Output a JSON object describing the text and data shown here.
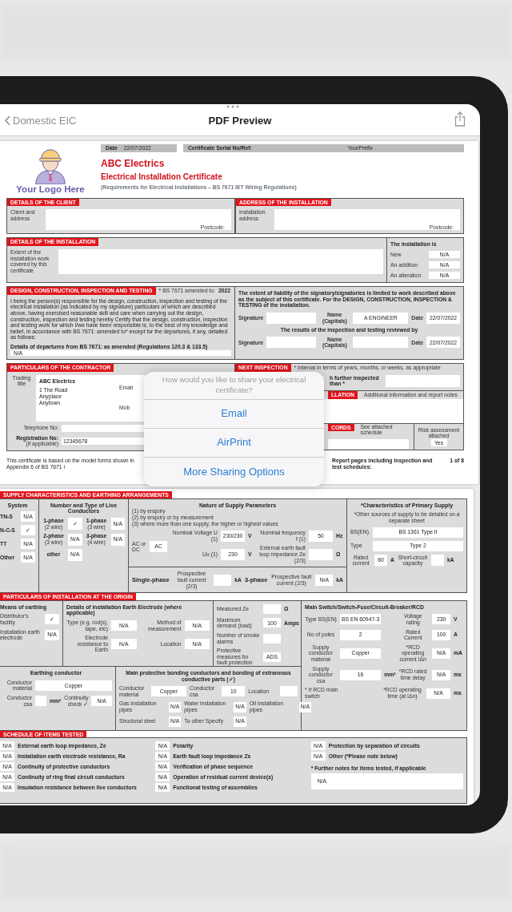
{
  "nav": {
    "back": "Domestic EIC",
    "title": "PDF Preview"
  },
  "page1": {
    "header": {
      "logo_text": "Your Logo Here",
      "date_label": "Date",
      "date": "22/07/2022",
      "serial_label": "Certificate Serial No/Ref:",
      "serial": "YourPrefix",
      "company": "ABC Electrics",
      "title": "Electrical Installation Certificate",
      "subtitle": "(Requirements for Electrical Installations – BS 7671 IET Wiring Regulations)"
    },
    "client": {
      "heading": "DETAILS OF THE CLIENT",
      "label": "Client and address",
      "postcode_label": "Postcode:"
    },
    "address": {
      "heading": "ADDRESS OF THE INSTALLATION",
      "label": "Installation address",
      "postcode_label": "Postcode:"
    },
    "installation": {
      "heading": "DETAILS OF THE INSTALLATION",
      "label": "Extent of the installation work covered by this certificate",
      "type_heading": "The installation is",
      "types": [
        {
          "label": "New",
          "value": "N/A"
        },
        {
          "label": "An addition",
          "value": "N/A"
        },
        {
          "label": "An alteration",
          "value": "N/A"
        }
      ]
    },
    "design": {
      "heading": "DESIGN, CONSTRUCTION, INSPECTION AND TESTING",
      "amended_label": "* BS 7671 amended to:",
      "amended_year": "2022",
      "statement": "I being the person(s) responsible for the design, construction, inspection and testing of the electrical installation (as indicated by my signature) particulars of which are described above, having exercised reasonable skill and care when carrying out the design, construction, inspection and testing hereby Certify that the design, construction, inspection and testing work for which I/we have been responsible is, to the best of my knowledge and belief, in accordance with BS 7671: amended to* except for the departures, if any, detailed as follows:",
      "departures_label": "Details of departures from BS 7671: as amended (Regulations 120.3 & 133.5)",
      "departures": "N/A"
    },
    "signatories": {
      "liability": "The extent of liability of the signatory/signatories is limited to work described above as the subject of this certificate. For the DESIGN, CONSTRUCTION, INSPECTION & TESTING of the installation.",
      "reviewed_label": "The results of the inspection and testing reviewed by",
      "rows": [
        {
          "signature_label": "Signature",
          "name_label": "Name (Capitals)",
          "name": "A ENGINEER",
          "date_label": "Date",
          "date": "22/07/2022"
        },
        {
          "signature_label": "Signature",
          "name_label": "Name (Capitals)",
          "date_label": "Date",
          "date": "22/07/2022"
        }
      ]
    },
    "contractor": {
      "heading": "PARTICULARS OF THE CONTRACTOR",
      "trading_label": "Trading title",
      "trading_name": "ABC Electrics",
      "address_lines": [
        "1 The Road",
        "Anyplace",
        "Anytown"
      ],
      "email_label": "Email",
      "mob_label": "Mob",
      "telephone_label": "Telephone No:",
      "registration_label": "Registration No:",
      "registration_note": "(if applicable)",
      "registration": "12345678"
    },
    "next_inspection": {
      "heading": "NEXT INSPECTION",
      "note": "* Interval in terms of years, months, or weeks, as appropriate",
      "recommend_lines": [
        "h further inspected",
        "than *"
      ]
    },
    "comments": {
      "heading": "LLATION",
      "label": "Additional information and report notes"
    },
    "records": {
      "heading": "CORDS",
      "label": "See attached schedule",
      "risk_label": "Risk assessment attached",
      "risk": "Yes"
    },
    "footer": {
      "basis": "This certificate is based on the model forms shown in Appendix 6 of BS 7671 i",
      "pages_label": "Report pages including inspection and test schedules:",
      "pages": "1 of 8"
    }
  },
  "share_sheet": {
    "prompt": "How would you like to share your electrical certificate?",
    "options": [
      "Email",
      "AirPrint",
      "More Sharing Options"
    ]
  },
  "page2": {
    "supply": {
      "heading": "SUPPLY CHARACTERISTICS AND EARTHING ARRANGEMENTS",
      "system": {
        "title": "System",
        "rows": [
          {
            "label": "TN-S",
            "value": "N/A"
          },
          {
            "label": "N-C-S",
            "value": "✓"
          },
          {
            "label": "TT",
            "value": "N/A"
          },
          {
            "label": "Other",
            "value": "N/A"
          }
        ]
      },
      "conductors": {
        "title": "Number and Type of Live Conductors",
        "rows": [
          {
            "label": "1-phase",
            "note": "(2 wire)",
            "value": "✓"
          },
          {
            "label": "1-phase",
            "note": "(3 wire)",
            "value": "N/A"
          },
          {
            "label": "2-phase",
            "note": "(3 wire)",
            "value": "N/A"
          },
          {
            "label": "3-phase",
            "note": "(4 wire)",
            "value": "N/A"
          },
          {
            "label": "other",
            "value": "N/A"
          }
        ]
      },
      "nature": {
        "title": "Nature of Supply Parameters",
        "notes": [
          "(1) by enquiry",
          "(2) by enquiry or by measurement",
          "(3) where more than one supply, the higher or highest values"
        ],
        "fields": [
          {
            "label": "AC or DC",
            "value": "AC"
          },
          {
            "label": "Nominal Voltage U (1)",
            "value": "230/230",
            "unit": "V"
          },
          {
            "label": "Nominal frequency f (1)",
            "value": "50",
            "unit": "Hz"
          },
          {
            "label": "Uo (1)",
            "value": "230",
            "unit": "V"
          },
          {
            "label": "External earth fault loop impedance Ze (2/3)",
            "unit": "Ω"
          }
        ],
        "fault": [
          {
            "phase": "Single-phase",
            "label": "Prospective fault current (2/3)",
            "unit": "kA"
          },
          {
            "phase": "3-phase",
            "label": "Prospective fault current (2/3)",
            "value": "N/A",
            "unit": "kA"
          }
        ]
      },
      "primary": {
        "title": "*Characteristics of Primary Supply",
        "note": "*Other sources of supply to be detailed on a separate sheet",
        "fields": [
          {
            "label": "BS(EN)",
            "value": "BS 1361 Type II"
          },
          {
            "label": "Type",
            "value": "Type 2"
          }
        ],
        "rated": {
          "label": "Rated current",
          "value": "60",
          "unit": "A"
        },
        "capacity": {
          "label": "Short-circuit capacity",
          "unit": "kA"
        }
      }
    },
    "origin": {
      "heading": "PARTICULARS OF INSTALLATION AT THE ORIGIN",
      "means": {
        "title": "Means of earthing",
        "rows": [
          {
            "label": "Distributor's facility",
            "value": "✓"
          },
          {
            "label": "Installation earth electrode",
            "value": "N/A"
          }
        ]
      },
      "electrode": {
        "title": "Details of installation Earth Electrode (where applicable)",
        "fields": [
          {
            "label": "Type (e.g. rod(s), tape, etc)",
            "value": "N/A"
          },
          {
            "label": "Method of measurement",
            "value": "N/A"
          },
          {
            "label": "Electrode resistance to Earth",
            "value": "N/A"
          },
          {
            "label": "Location",
            "value": "N/A"
          }
        ]
      },
      "measured": [
        {
          "label": "Measured Ze",
          "unit": "Ω"
        },
        {
          "label": "Maximum demand (load)",
          "value": "100",
          "unit": "Amps"
        },
        {
          "label": "Number of smoke alarms"
        },
        {
          "label": "Protective measures for fault protection",
          "value": "ADS"
        }
      ],
      "main_switch": {
        "title": "Main Switch/Switch-Fuse/Circuit-Breaker/RCD",
        "fields": [
          {
            "label": "Type BS(EN)",
            "value": "BS EN 60947-3"
          },
          {
            "label": "Voltage rating",
            "value": "230",
            "unit": "V"
          },
          {
            "label": "No of poles",
            "value": "2"
          },
          {
            "label": "Rated Current",
            "value": "100",
            "unit": "A"
          },
          {
            "label": "Supply conductor material",
            "value": "Copper"
          },
          {
            "label": "*RCD operating current IΔn",
            "value": "N/A",
            "unit": "mA"
          },
          {
            "label": "Supply conductor csa",
            "value": "16",
            "unit": "mm²"
          },
          {
            "label": "*RCD rated time delay",
            "value": "N/A",
            "unit": "ms"
          }
        ],
        "last": {
          "label": "*RCD operating time (at IΔn)",
          "value": "N/A",
          "unit": "ms"
        },
        "note": "* If RCD main switch"
      },
      "earthing": {
        "title": "Earthing conductor",
        "material_label": "Conductor material",
        "material": "Copper",
        "csa_label": "Conductor csa",
        "csa_unit": "mm²",
        "continuity_label": "Continuity check ✓",
        "continuity": "N/A"
      },
      "bonding": {
        "title": "Main protective bonding conductors and bonding of extraneous conductive parts (✓)",
        "fields": [
          {
            "label": "Conductor material",
            "value": "Copper"
          },
          {
            "label": "Conductor csa",
            "value": "10"
          },
          {
            "label": "Location"
          }
        ],
        "parts": [
          {
            "label": "Gas installation pipes",
            "value": "N/A"
          },
          {
            "label": "Water installation pipes",
            "value": "N/A"
          },
          {
            "label": "Oil installation pipes",
            "value": "N/A"
          },
          {
            "label": "Structural steel",
            "value": "N/A"
          },
          {
            "label": "To other Specify",
            "value": "N/A"
          }
        ]
      }
    },
    "schedule": {
      "heading": "SCHEDULE OF ITEMS TESTED",
      "columns": [
        [
          {
            "value": "N/A",
            "label": "External earth loop impedance, Ze"
          },
          {
            "value": "N/A",
            "label": "Installation earth electrode resistance, Ra"
          },
          {
            "value": "N/A",
            "label": "Continuity of protective conductors"
          },
          {
            "value": "N/A",
            "label": "Continuity of ring final circuit conductors"
          },
          {
            "value": "N/A",
            "label": "Insulation resistance between live conductors"
          }
        ],
        [
          {
            "value": "N/A",
            "label": "Polarity"
          },
          {
            "value": "N/A",
            "label": "Earth fault loop impedance Zs"
          },
          {
            "value": "N/A",
            "label": "Verification of phase sequence"
          },
          {
            "value": "N/A",
            "label": "Operation of residual current device(s)"
          },
          {
            "value": "N/A",
            "label": "Functional testing of assemblies"
          }
        ],
        [
          {
            "value": "N/A",
            "label": "Protection by separation of circuits"
          },
          {
            "value": "N/A",
            "label": "Other (*Please note below)"
          }
        ]
      ],
      "notes_label": "* Further notes for items tested, if applicable",
      "notes": "N/A"
    }
  }
}
